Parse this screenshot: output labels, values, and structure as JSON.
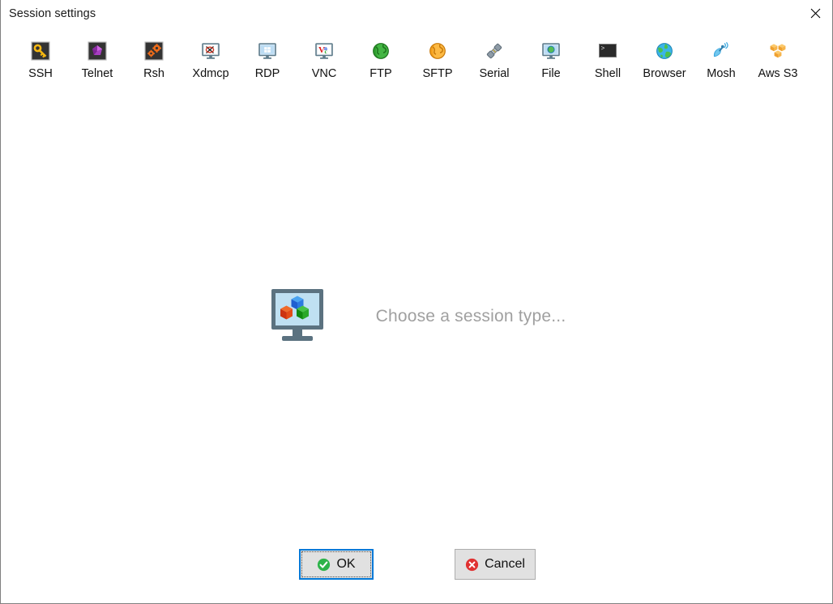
{
  "window": {
    "title": "Session settings",
    "close_icon": "close-icon"
  },
  "toolbar": {
    "items": [
      {
        "label": "SSH",
        "icon": "ssh-key-icon"
      },
      {
        "label": "Telnet",
        "icon": "telnet-gem-icon"
      },
      {
        "label": "Rsh",
        "icon": "rsh-gears-icon"
      },
      {
        "label": "Xdmcp",
        "icon": "xdmcp-monitor-x-icon"
      },
      {
        "label": "RDP",
        "icon": "rdp-monitor-windows-icon"
      },
      {
        "label": "VNC",
        "icon": "vnc-monitor-icon"
      },
      {
        "label": "FTP",
        "icon": "ftp-green-globe-icon"
      },
      {
        "label": "SFTP",
        "icon": "sftp-orange-globe-icon"
      },
      {
        "label": "Serial",
        "icon": "serial-plug-icon"
      },
      {
        "label": "File",
        "icon": "file-monitor-globe-icon"
      },
      {
        "label": "Shell",
        "icon": "shell-terminal-icon"
      },
      {
        "label": "Browser",
        "icon": "browser-globe-icon"
      },
      {
        "label": "Mosh",
        "icon": "mosh-satellite-icon"
      },
      {
        "label": "Aws S3",
        "icon": "aws-s3-cubes-icon"
      }
    ]
  },
  "main": {
    "placeholder_text": "Choose a session type...",
    "placeholder_icon": "monitor-cubes-icon"
  },
  "footer": {
    "ok_label": "OK",
    "ok_icon": "green-check-icon",
    "cancel_label": "Cancel",
    "cancel_icon": "red-x-icon"
  },
  "colors": {
    "focus_blue": "#0078d7",
    "button_face": "#e1e1e1",
    "button_border": "#adadad",
    "placeholder_gray": "#a0a0a0",
    "icon_dark": "#333333"
  }
}
